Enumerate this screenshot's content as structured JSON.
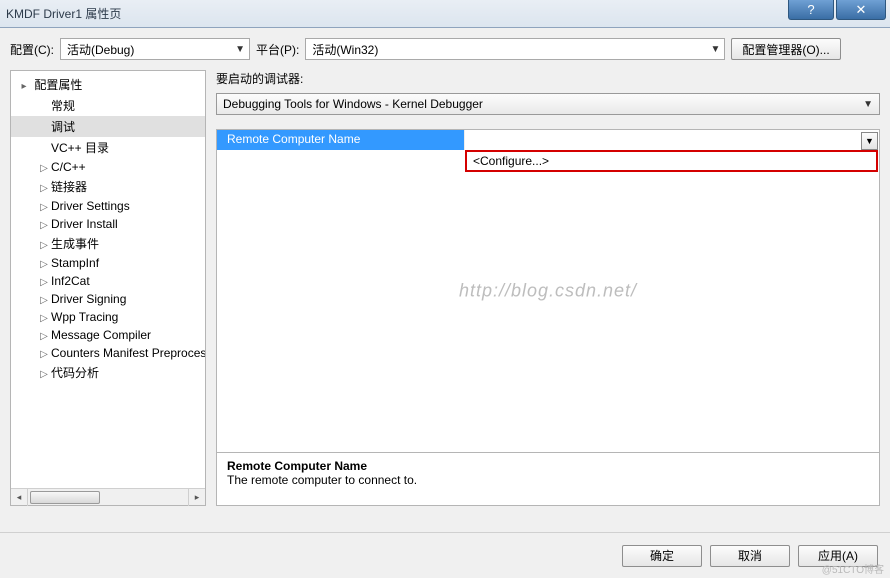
{
  "window": {
    "title": "KMDF Driver1 属性页",
    "help_glyph": "?",
    "close_glyph": "✕"
  },
  "toolbar": {
    "config_label": "配置(C):",
    "config_value": "活动(Debug)",
    "platform_label": "平台(P):",
    "platform_value": "活动(Win32)",
    "manager_label": "配置管理器(O)..."
  },
  "tree": {
    "root": "配置属性",
    "items": [
      {
        "label": "常规",
        "expandable": false
      },
      {
        "label": "调试",
        "expandable": false,
        "selected": true
      },
      {
        "label": "VC++ 目录",
        "expandable": false
      },
      {
        "label": "C/C++",
        "expandable": true
      },
      {
        "label": "链接器",
        "expandable": true
      },
      {
        "label": "Driver Settings",
        "expandable": true
      },
      {
        "label": "Driver Install",
        "expandable": true
      },
      {
        "label": "生成事件",
        "expandable": true
      },
      {
        "label": "StampInf",
        "expandable": true
      },
      {
        "label": "Inf2Cat",
        "expandable": true
      },
      {
        "label": "Driver Signing",
        "expandable": true
      },
      {
        "label": "Wpp Tracing",
        "expandable": true
      },
      {
        "label": "Message Compiler",
        "expandable": true
      },
      {
        "label": "Counters Manifest Preprocessor",
        "expandable": true
      },
      {
        "label": "代码分析",
        "expandable": true
      }
    ]
  },
  "main": {
    "debugger_label": "要启动的调试器:",
    "debugger_value": "Debugging Tools for Windows - Kernel Debugger",
    "grid": {
      "row_label": "Remote Computer Name",
      "dropdown_option": "<Configure...>"
    },
    "help": {
      "title": "Remote Computer Name",
      "desc": "The remote computer to connect to."
    },
    "watermark": "http://blog.csdn.net/"
  },
  "buttons": {
    "ok": "确定",
    "cancel": "取消",
    "apply": "应用(A)"
  },
  "corner_mark": "@51CTO博客"
}
